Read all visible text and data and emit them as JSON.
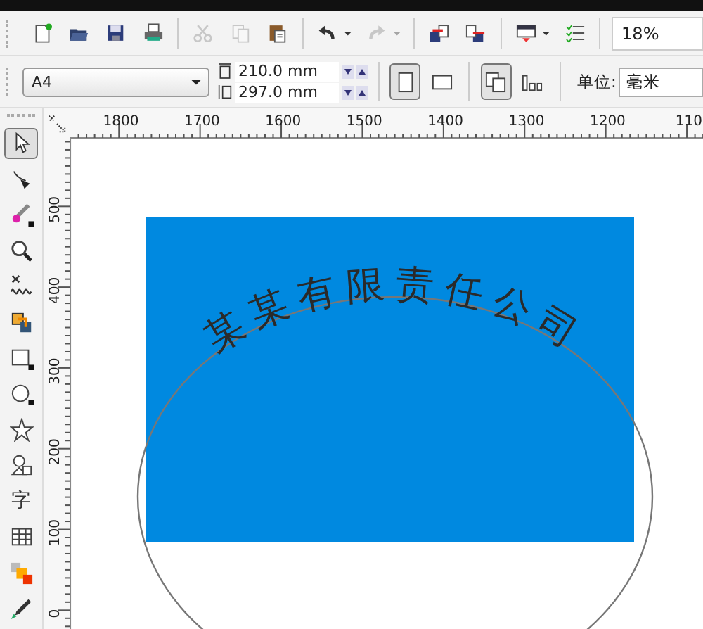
{
  "standard_toolbar": [
    {
      "kind": "new",
      "disabled": false
    },
    {
      "kind": "open",
      "disabled": false
    },
    {
      "kind": "save",
      "disabled": false
    },
    {
      "kind": "print",
      "disabled": false
    },
    {
      "kind": "separator"
    },
    {
      "kind": "cut",
      "disabled": true
    },
    {
      "kind": "copy",
      "disabled": true
    },
    {
      "kind": "paste",
      "disabled": false
    },
    {
      "kind": "separator"
    },
    {
      "kind": "undo",
      "disabled": false
    },
    {
      "kind": "caret",
      "disabled": false
    },
    {
      "kind": "redo",
      "disabled": true
    },
    {
      "kind": "caret",
      "disabled": true
    },
    {
      "kind": "separator"
    },
    {
      "kind": "import",
      "disabled": false
    },
    {
      "kind": "export",
      "disabled": false
    },
    {
      "kind": "separator"
    },
    {
      "kind": "publish",
      "disabled": false
    },
    {
      "kind": "caret",
      "disabled": false
    },
    {
      "kind": "options",
      "disabled": false
    },
    {
      "kind": "separator"
    }
  ],
  "zoom": {
    "value": "18%"
  },
  "property_bar": {
    "page_size": "A4",
    "width": "210.0 mm",
    "height": "297.0 mm",
    "orientation": [
      {
        "kind": "portrait",
        "selected": true
      },
      {
        "kind": "landscape",
        "selected": false
      }
    ],
    "page_layout": [
      {
        "kind": "all_pages",
        "selected": true
      },
      {
        "kind": "current_page",
        "selected": false
      }
    ],
    "unit_label": "单位:",
    "unit": "毫米"
  },
  "horizontal_ruler": [
    "1800",
    "1700",
    "1600",
    "1500",
    "1400",
    "1300",
    "1200",
    "110"
  ],
  "vertical_ruler": [
    "500",
    "400",
    "300",
    "200",
    "100",
    "0"
  ],
  "toolbox": [
    {
      "kind": "pick",
      "selected": true
    },
    {
      "kind": "shape",
      "selected": false
    },
    {
      "kind": "smear",
      "selected": false
    },
    {
      "kind": "zoom",
      "selected": false
    },
    {
      "kind": "freehand",
      "selected": false
    },
    {
      "kind": "smart_fill",
      "selected": false
    },
    {
      "kind": "rectangle",
      "selected": false
    },
    {
      "kind": "ellipse",
      "selected": false
    },
    {
      "kind": "star",
      "selected": false
    },
    {
      "kind": "basic_shapes",
      "selected": false
    },
    {
      "kind": "text",
      "label": "字",
      "selected": false
    },
    {
      "kind": "table",
      "selected": false
    },
    {
      "kind": "interactive",
      "selected": false
    },
    {
      "kind": "eyedropper",
      "selected": false
    }
  ],
  "canvas": {
    "curved_text": "某某有限责任公司"
  }
}
